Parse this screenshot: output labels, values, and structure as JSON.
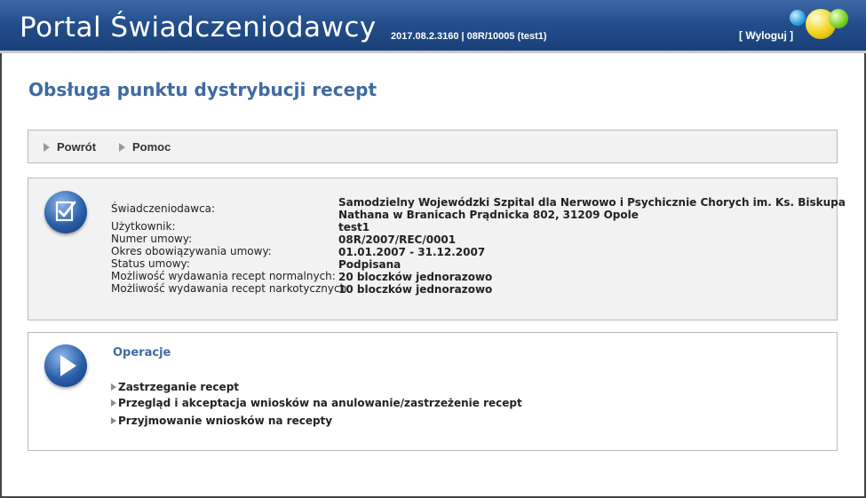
{
  "header": {
    "app_title": "Portal Świadczeniodawcy",
    "version": "2017.08.2.3160 | 08R/10005 (test1)",
    "logout_label": "[ Wyloguj ]"
  },
  "page": {
    "title": "Obsługa punktu dystrybucji recept"
  },
  "nav": {
    "back_label": "Powrót",
    "help_label": "Pomoc"
  },
  "info": {
    "icon": "checklist-icon",
    "labels": {
      "provider": "Świadczeniodawca:",
      "user": "Użytkownik:",
      "contract_number": "Numer umowy:",
      "validity": "Okres obowiązywania umowy:",
      "status": "Status umowy:",
      "normal_rx": "Możliwość wydawania recept normalnych:",
      "narcotic_rx": "Możliwość wydawania recept narkotycznych:"
    },
    "values": {
      "provider_line1": "Samodzielny Wojewódzki Szpital dla Nerwowo i Psychicznie Chorych im. Ks. Biskupa",
      "provider_line2": "Nathana w Branicach Prądnicka 802, 31209 Opole",
      "user": "test1",
      "contract_number": "08R/2007/REC/0001",
      "validity": "01.01.2007 - 31.12.2007",
      "status": "Podpisana",
      "normal_rx": "20 bloczków jednorazowo",
      "narcotic_rx": "10 bloczków jednorazowo"
    }
  },
  "operations": {
    "icon": "play-icon",
    "title": "Operacje",
    "items": [
      "Zastrzeganie recept",
      "Przegląd i akceptacja wniosków na anulowanie/zastrzeżenie recept",
      "Przyjmowanie wniosków na recepty"
    ]
  },
  "colors": {
    "header_blue": "#244f8c",
    "title_blue": "#3f6aa3",
    "panel_gray": "#f2f2f2"
  }
}
